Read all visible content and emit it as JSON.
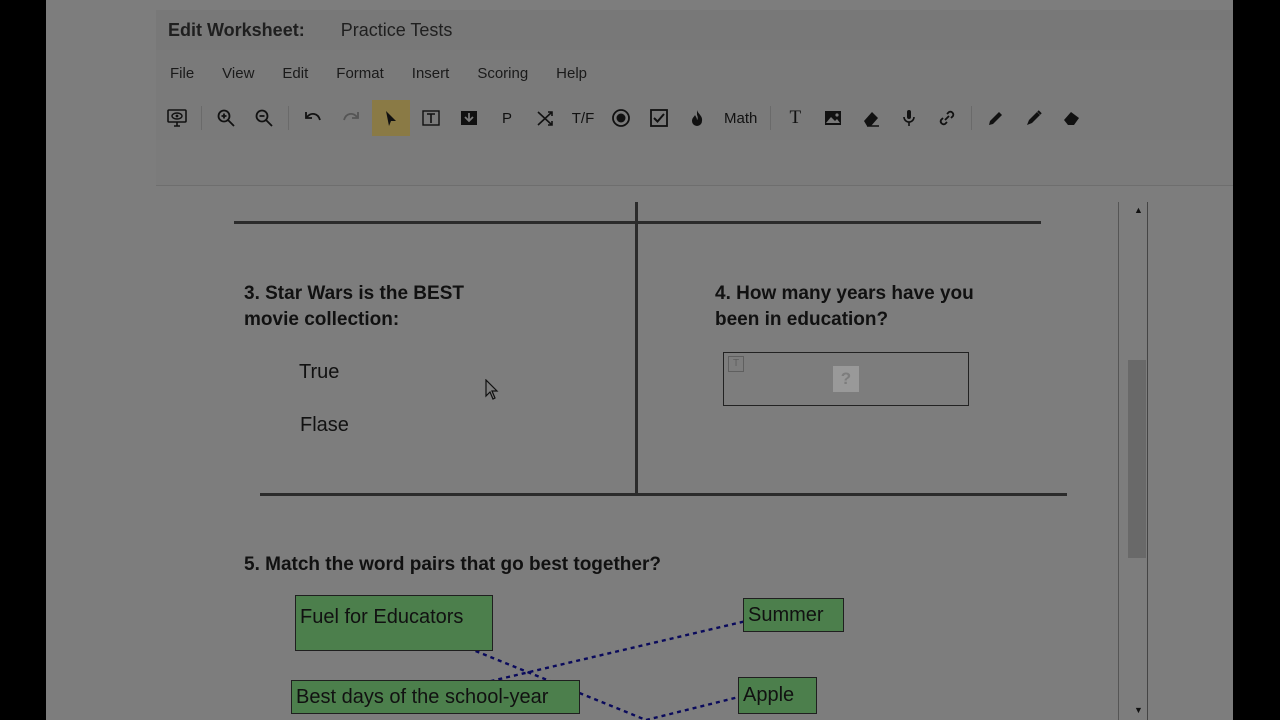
{
  "header": {
    "title_label": "Edit Worksheet:",
    "title_value": "Practice Tests"
  },
  "menu": [
    "File",
    "View",
    "Edit",
    "Format",
    "Insert",
    "Scoring",
    "Help"
  ],
  "toolbar": {
    "p_label": "P",
    "tf_label": "T/F",
    "math_label": "Math",
    "text_label": "T"
  },
  "questions": {
    "q3": {
      "line1": "3. Star Wars is the BEST",
      "line2": "movie collection:",
      "options": [
        "True",
        "Flase"
      ]
    },
    "q4": {
      "line1": "4. How many years have you",
      "line2": "been in education?",
      "help_glyph": "?",
      "text_glyph": "T"
    },
    "q5": {
      "title": "5. Match the word pairs that go best together?",
      "left": [
        "Fuel for Educators",
        "Best days of the school-year"
      ],
      "right": [
        "Summer",
        "Apple"
      ]
    }
  },
  "colors": {
    "match_box": "#4c7f4c",
    "connector": "#0a0a5c",
    "active_tool": "#8a7a45"
  }
}
